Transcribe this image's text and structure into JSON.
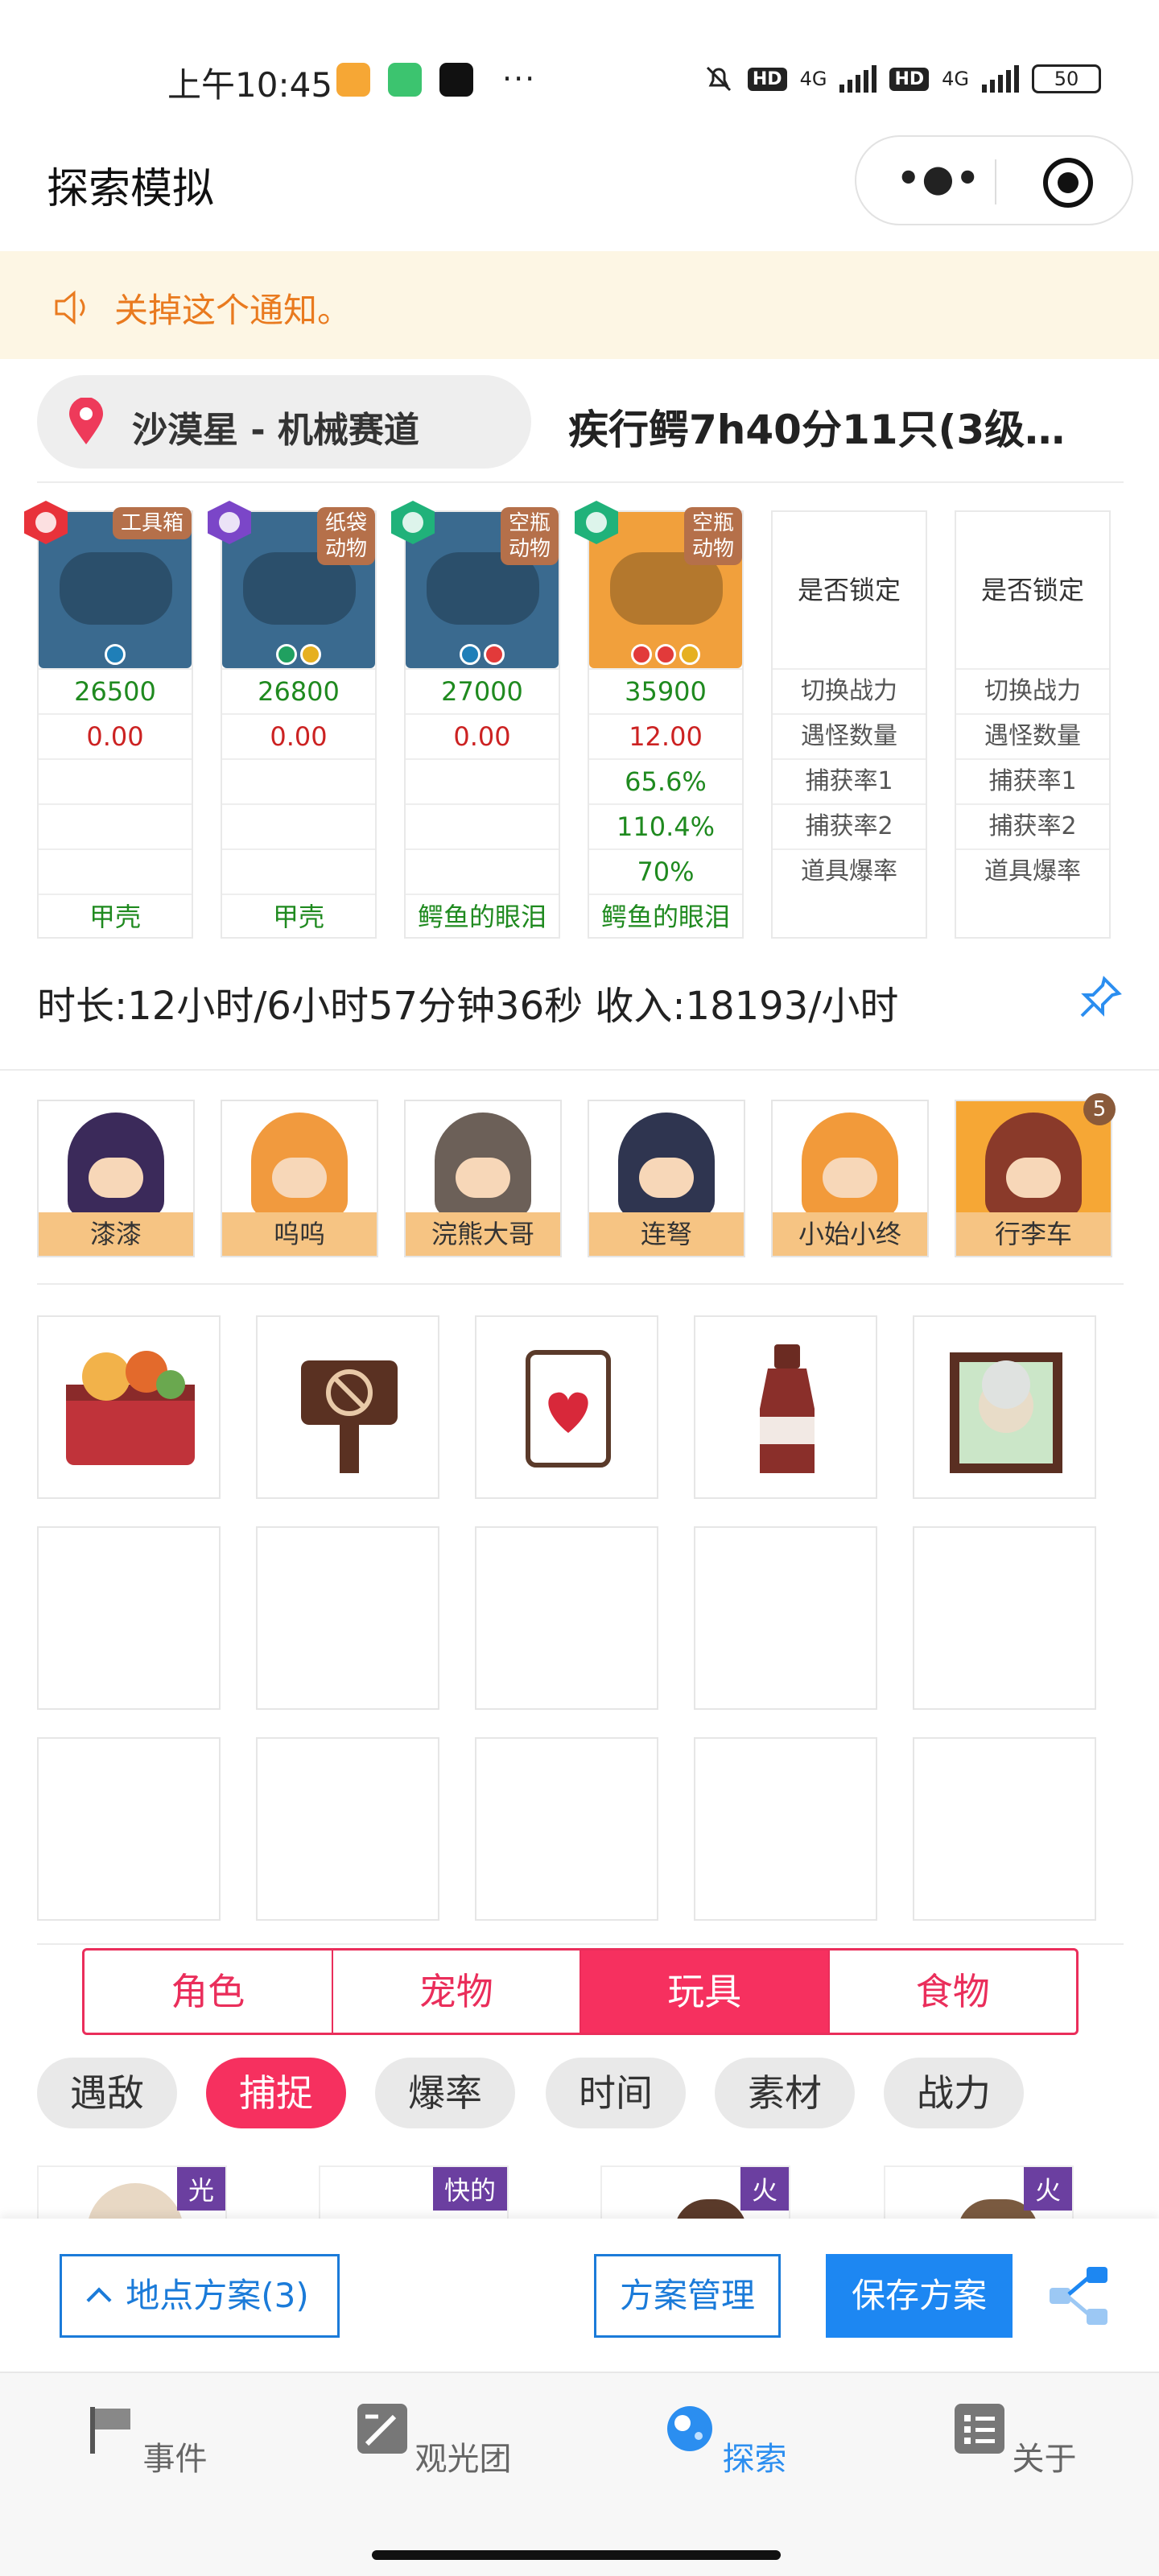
{
  "status_bar": {
    "time": "上午10:45",
    "battery": "50",
    "net1": "4G",
    "net2": "4G",
    "hd": "HD"
  },
  "header": {
    "title": "探索模拟"
  },
  "notice": {
    "text": "关掉这个通知。"
  },
  "location": {
    "name": "沙漠星 - 机械赛道",
    "title": "疾行鳄7h40分11只(3级…"
  },
  "team": [
    {
      "tag": "工具箱",
      "power": "26500",
      "value": "0.00",
      "rate1": "",
      "rate2": "",
      "drop": "",
      "item": "甲壳",
      "color": "#3a6a8f"
    },
    {
      "tag": "纸袋\n动物",
      "power": "26800",
      "value": "0.00",
      "rate1": "",
      "rate2": "",
      "drop": "",
      "item": "甲壳",
      "color": "#3a6a8f"
    },
    {
      "tag": "空瓶\n动物",
      "power": "27000",
      "value": "0.00",
      "rate1": "",
      "rate2": "",
      "drop": "",
      "item": "鳄鱼的眼泪",
      "color": "#3a6a8f"
    },
    {
      "tag": "空瓶\n动物",
      "power": "35900",
      "value": "12.00",
      "rate1": "65.6%",
      "rate2": "110.4%",
      "drop": "70%",
      "item": "鳄鱼的眼泪",
      "color": "#f1a03c"
    }
  ],
  "lock_cols": [
    {
      "lock": "是否锁定",
      "rows": [
        "切换战力",
        "遇怪数量",
        "捕获率1",
        "捕获率2",
        "道具爆率"
      ]
    },
    {
      "lock": "是否锁定",
      "rows": [
        "切换战力",
        "遇怪数量",
        "捕获率1",
        "捕获率2",
        "道具爆率"
      ]
    }
  ],
  "duration": "时长:12小时/6小时57分钟36秒 收入:18193/小时",
  "characters": [
    "漆漆",
    "呜呜",
    "浣熊大哥",
    "连弩",
    "小始小终",
    "行李车"
  ],
  "luggage_badge": "5",
  "tabs": [
    "角色",
    "宠物",
    "玩具",
    "食物"
  ],
  "chips": [
    "遇敌",
    "捕捉",
    "爆率",
    "时间",
    "素材",
    "战力"
  ],
  "partial_tags": [
    "光",
    "快的",
    "火",
    "火"
  ],
  "actions": {
    "plan": "地点方案(3)",
    "manage": "方案管理",
    "save": "保存方案"
  },
  "tabbar": [
    "事件",
    "观光团",
    "探索",
    "关于"
  ]
}
